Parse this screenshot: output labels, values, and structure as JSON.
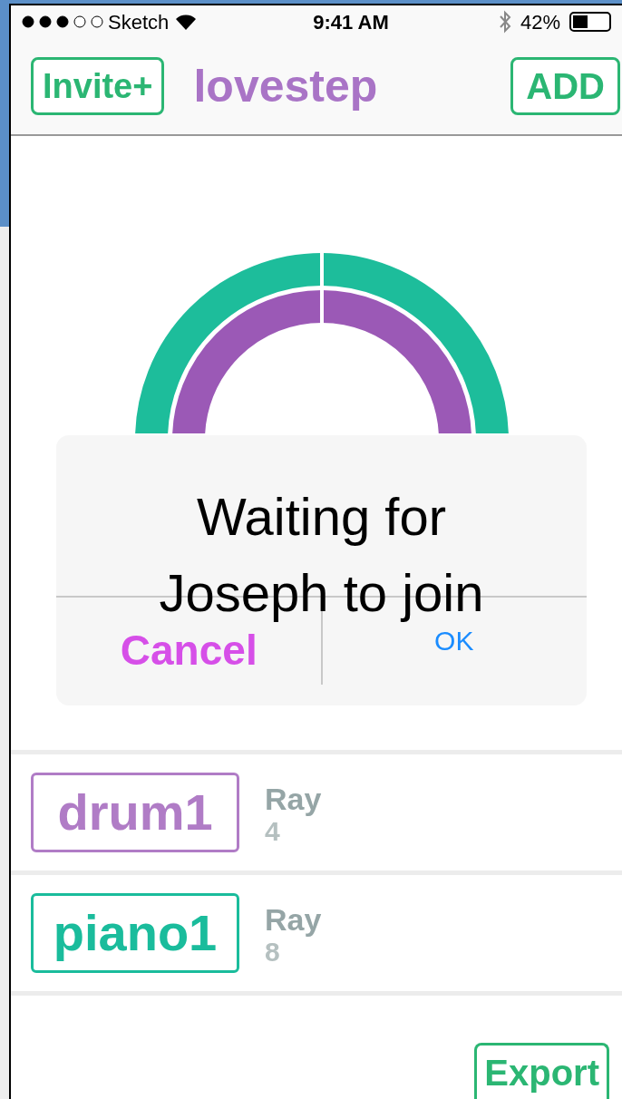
{
  "status_bar": {
    "carrier": "Sketch",
    "time": "9:41 AM",
    "battery": "42%"
  },
  "nav": {
    "left_button": "Invite+",
    "title": "lovestep",
    "right_button": "ADD"
  },
  "dialog": {
    "message": "Waiting for Joseph to join",
    "cancel": "Cancel",
    "ok": "OK"
  },
  "tracks": [
    {
      "name": "drum1",
      "color": "#b07cc6",
      "owner": "Ray",
      "count": "4"
    },
    {
      "name": "piano1",
      "color": "#1abc9c",
      "owner": "Ray",
      "count": "8"
    }
  ],
  "export_button": "Export"
}
